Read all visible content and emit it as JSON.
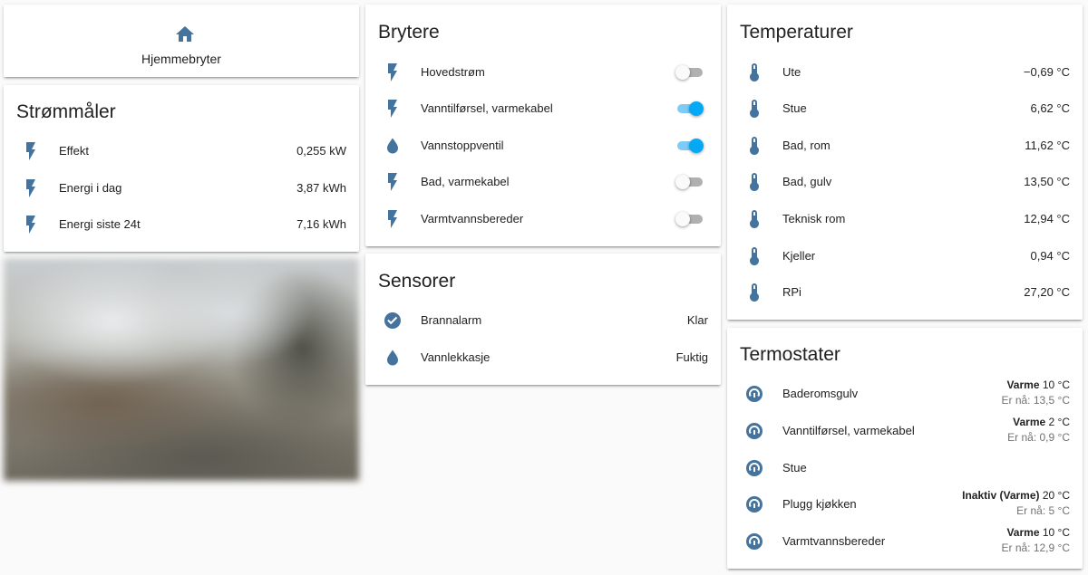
{
  "colors": {
    "icon": "#44739e",
    "toggle_on": "#03a9f4",
    "toggle_off": "#b0b0b0",
    "background": "#fafafa",
    "card": "#ffffff"
  },
  "home_button": {
    "label": "Hjemmebryter",
    "icon": "home-icon"
  },
  "stromm": {
    "title": "Strømmåler",
    "rows": [
      {
        "icon": "flash-icon",
        "label": "Effekt",
        "value": "0,255 kW"
      },
      {
        "icon": "flash-icon",
        "label": "Energi i dag",
        "value": "3,87 kWh"
      },
      {
        "icon": "flash-icon",
        "label": "Energi siste 24t",
        "value": "7,16 kWh"
      }
    ]
  },
  "camera": {
    "description_visible": false
  },
  "brytere": {
    "title": "Brytere",
    "rows": [
      {
        "icon": "flash-icon",
        "label": "Hovedstrøm",
        "state": "off"
      },
      {
        "icon": "flash-icon",
        "label": "Vanntilførsel, varmekabel",
        "state": "on"
      },
      {
        "icon": "water-icon",
        "label": "Vannstoppventil",
        "state": "on"
      },
      {
        "icon": "flash-icon",
        "label": "Bad, varmekabel",
        "state": "off"
      },
      {
        "icon": "flash-icon",
        "label": "Varmtvannsbereder",
        "state": "off"
      }
    ]
  },
  "sensorer": {
    "title": "Sensorer",
    "rows": [
      {
        "icon": "check-circle-icon",
        "label": "Brannalarm",
        "value": "Klar"
      },
      {
        "icon": "water-icon",
        "label": "Vannlekkasje",
        "value": "Fuktig"
      }
    ]
  },
  "temperaturer": {
    "title": "Temperaturer",
    "rows": [
      {
        "icon": "thermometer-icon",
        "label": "Ute",
        "value": "−0,69 °C"
      },
      {
        "icon": "thermometer-icon",
        "label": "Stue",
        "value": "6,62 °C"
      },
      {
        "icon": "thermometer-icon",
        "label": "Bad, rom",
        "value": "11,62 °C"
      },
      {
        "icon": "thermometer-icon",
        "label": "Bad, gulv",
        "value": "13,50 °C"
      },
      {
        "icon": "thermometer-icon",
        "label": "Teknisk rom",
        "value": "12,94 °C"
      },
      {
        "icon": "thermometer-icon",
        "label": "Kjeller",
        "value": "0,94 °C"
      },
      {
        "icon": "thermometer-icon",
        "label": "RPi",
        "value": "27,20 °C"
      }
    ]
  },
  "termostater": {
    "title": "Termostater",
    "rows": [
      {
        "icon": "thermostat-icon",
        "label": "Baderomsgulv",
        "mode": "Varme",
        "target": "10 °C",
        "current": "Er nå: 13,5 °C"
      },
      {
        "icon": "thermostat-icon",
        "label": "Vanntilførsel, varmekabel",
        "mode": "Varme",
        "target": "2 °C",
        "current": "Er nå: 0,9 °C"
      },
      {
        "icon": "thermostat-icon",
        "label": "Stue",
        "mode": "",
        "target": "",
        "current": ""
      },
      {
        "icon": "thermostat-icon",
        "label": "Plugg kjøkken",
        "mode": "Inaktiv (Varme)",
        "target": "20 °C",
        "current": "Er nå: 5 °C"
      },
      {
        "icon": "thermostat-icon",
        "label": "Varmtvannsbereder",
        "mode": "Varme",
        "target": "10 °C",
        "current": "Er nå: 12,9 °C"
      }
    ]
  }
}
